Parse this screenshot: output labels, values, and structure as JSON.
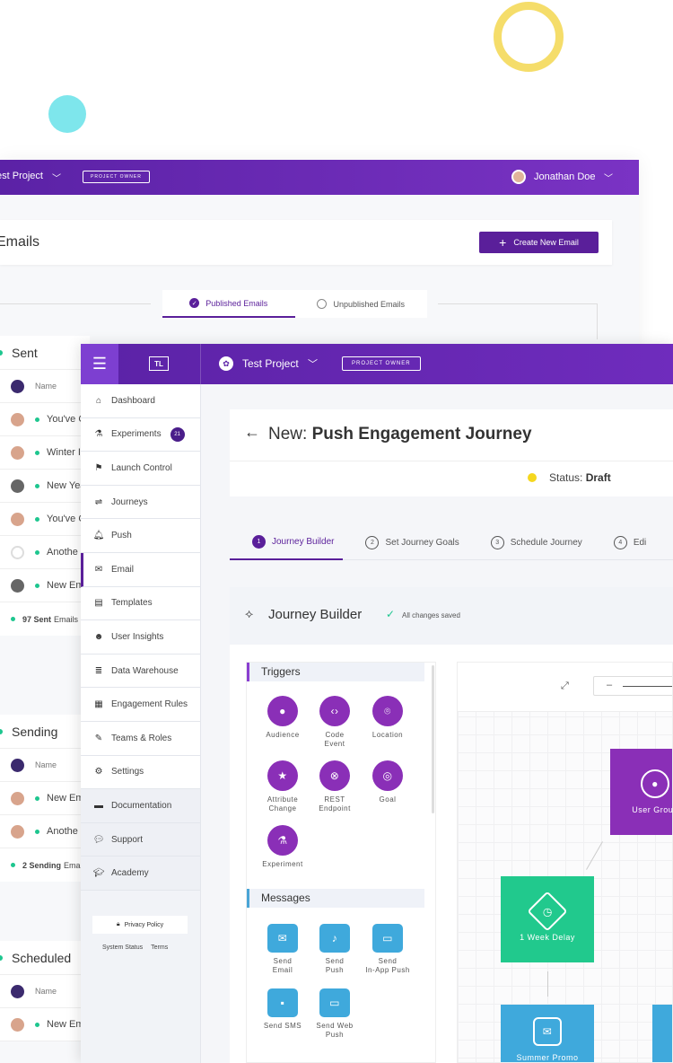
{
  "back_window": {
    "project": "est Project",
    "badge": "PROJECT OWNER",
    "user": "Jonathan Doe",
    "title": "Emails",
    "create_button": "Create New Email",
    "tabs": [
      "Published Emails",
      "Unpublished Emails"
    ],
    "sections": [
      {
        "title": "Sent",
        "header": "Name",
        "rows": [
          "You've C",
          "Winter I",
          "New Yea",
          "You've C",
          "Anothe",
          "New Em"
        ],
        "count_num": "97 Sent",
        "count_label": "Emails"
      },
      {
        "title": "Sending",
        "header": "Name",
        "rows": [
          "New Em",
          "Anothe"
        ],
        "count_num": "2 Sending",
        "count_label": "Email"
      },
      {
        "title": "Scheduled",
        "header": "Name",
        "rows": [
          "New Em"
        ]
      }
    ]
  },
  "front_window": {
    "logo": "TL",
    "project": "Test Project",
    "badge": "PROJECT OWNER",
    "nav": [
      {
        "label": "Dashboard",
        "icon": "home-icon"
      },
      {
        "label": "Experiments",
        "icon": "flask-icon",
        "count": "21"
      },
      {
        "label": "Launch Control",
        "icon": "flag-icon"
      },
      {
        "label": "Journeys",
        "icon": "signpost-icon"
      },
      {
        "label": "Push",
        "icon": "bell-icon"
      },
      {
        "label": "Email",
        "icon": "envelope-icon"
      },
      {
        "label": "Templates",
        "icon": "template-icon"
      },
      {
        "label": "User Insights",
        "icon": "users-icon"
      },
      {
        "label": "Data Warehouse",
        "icon": "database-icon"
      },
      {
        "label": "Engagement Rules",
        "icon": "clipboard-icon"
      },
      {
        "label": "Teams & Roles",
        "icon": "user-edit-icon"
      },
      {
        "label": "Settings",
        "icon": "gears-icon"
      },
      {
        "label": "Documentation",
        "icon": "book-icon"
      },
      {
        "label": "Support",
        "icon": "chat-icon"
      },
      {
        "label": "Academy",
        "icon": "grad-cap-icon"
      }
    ],
    "privacy": "Privacy Policy",
    "system_status": "System Status",
    "terms": "Terms",
    "journey_prefix": "New:",
    "journey_title": "Push Engagement Journey",
    "status_label": "Status:",
    "status_value": "Draft",
    "steps": [
      {
        "num": "1",
        "label": "Journey Builder"
      },
      {
        "num": "2",
        "label": "Set Journey Goals"
      },
      {
        "num": "3",
        "label": "Schedule Journey"
      },
      {
        "num": "4",
        "label": "Edi"
      }
    ],
    "builder_title": "Journey Builder",
    "saved": "All changes saved",
    "triggers_title": "Triggers",
    "triggers": [
      {
        "line1": "Audience",
        "line2": "",
        "icon": "person-icon"
      },
      {
        "line1": "Code",
        "line2": "Event",
        "icon": "code-icon"
      },
      {
        "line1": "Location",
        "line2": "",
        "icon": "pin-icon"
      },
      {
        "line1": "Attribute",
        "line2": "Change",
        "icon": "star-icon"
      },
      {
        "line1": "REST",
        "line2": "Endpoint",
        "icon": "rest-icon"
      },
      {
        "line1": "Goal",
        "line2": "",
        "icon": "target-icon"
      },
      {
        "line1": "Experiment",
        "line2": "",
        "icon": "flask-icon"
      }
    ],
    "messages_title": "Messages",
    "messages": [
      {
        "line1": "Send",
        "line2": "Email",
        "icon": "envelope-icon"
      },
      {
        "line1": "Send",
        "line2": "Push",
        "icon": "bell-icon"
      },
      {
        "line1": "Send",
        "line2": "In-App Push",
        "icon": "inapp-icon"
      },
      {
        "line1": "Send SMS",
        "line2": "",
        "icon": "sms-icon"
      },
      {
        "line1": "Send Web",
        "line2": "Push",
        "icon": "monitor-icon"
      }
    ],
    "nodes": {
      "user_group": "User Group",
      "delay": "1 Week Delay",
      "promo": "Summer Promo"
    }
  }
}
